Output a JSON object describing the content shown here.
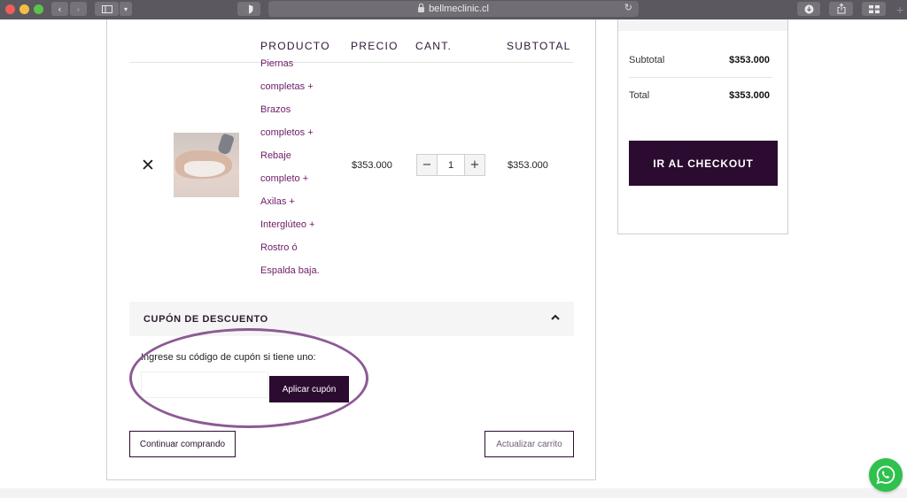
{
  "browser": {
    "url": "bellmeclinic.cl",
    "icons": [
      "back-icon",
      "forward-icon",
      "sidebar-icon",
      "shield-icon",
      "lock-icon",
      "reload-icon",
      "download-icon",
      "share-icon",
      "tabs-icon",
      "new-tab-icon"
    ]
  },
  "cart": {
    "headers": {
      "product": "PRODUCTO",
      "price": "PRECIO",
      "quantity": "CANT.",
      "subtotal": "SUBTOTAL"
    },
    "item": {
      "remove_label": "✕",
      "name_lines": [
        "Piernas",
        "completas +",
        "Brazos",
        "completos +",
        "Rebaje",
        "completo +",
        "Axilas +",
        "Interglúteo +",
        "Rostro ó",
        "Espalda baja."
      ],
      "price": "$353.000",
      "quantity": "1",
      "decrement": "−",
      "increment": "+",
      "subtotal": "$353.000"
    },
    "coupon": {
      "title": "CUPÓN DE DESCUENTO",
      "prompt": "Ingrese su código de cupón si tiene uno:",
      "input_value": "",
      "input_placeholder": "",
      "apply_label": "Aplicar cupón"
    },
    "continue_label": "Continuar comprando",
    "update_label": "Actualizar carrito"
  },
  "totals": {
    "subtotal_label": "Subtotal",
    "subtotal_value": "$353.000",
    "total_label": "Total",
    "total_value": "$353.000",
    "checkout_label": "IR AL CHECKOUT"
  },
  "colors": {
    "brand_dark": "#2b0c30",
    "product_link": "#6e1b66",
    "annotation": "#8d5a95",
    "whatsapp": "#2fc14d"
  }
}
